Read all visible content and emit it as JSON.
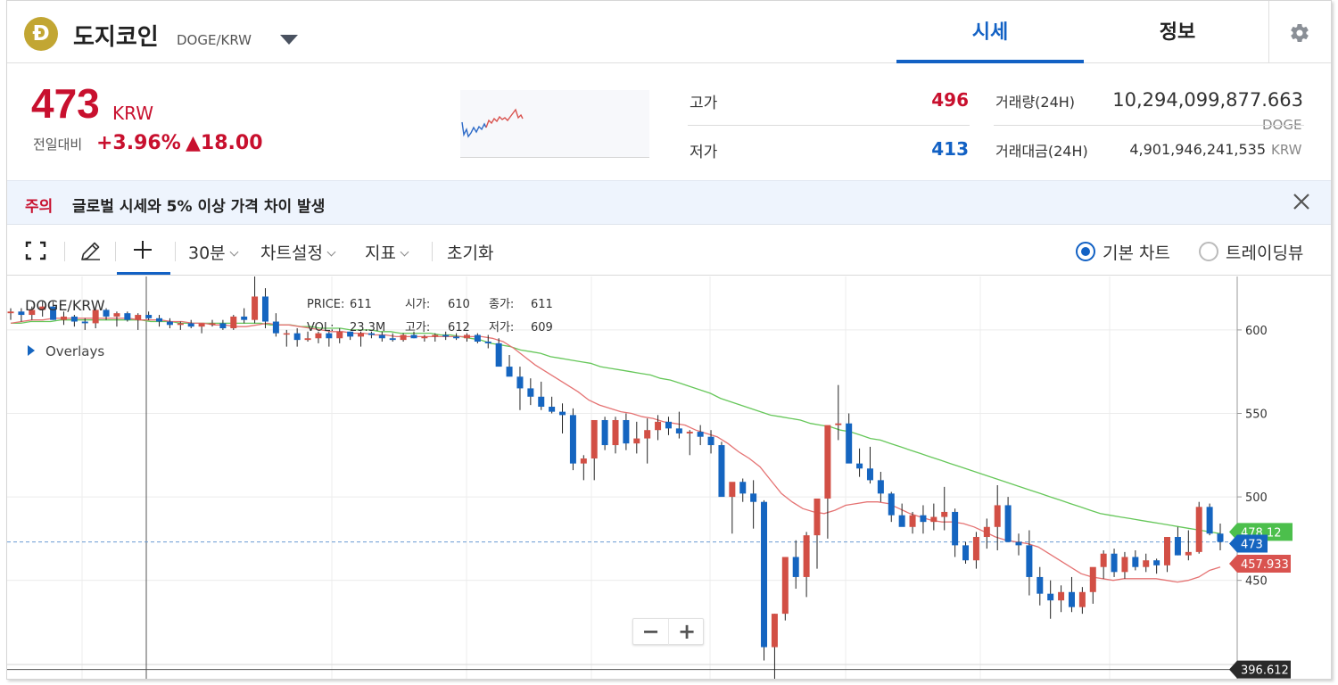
{
  "header": {
    "coin_symbol_glyph": "Ð",
    "coin_name": "도지코인",
    "pair": "DOGE/KRW",
    "tabs": [
      {
        "label": "시세",
        "active": true
      },
      {
        "label": "정보",
        "active": false
      }
    ]
  },
  "price": {
    "current": "473",
    "unit": "KRW",
    "prev_label": "전일대비",
    "change_pct": "+3.96%",
    "change_abs": "▲18.00"
  },
  "stats": {
    "high_label": "고가",
    "high_value": "496",
    "low_label": "저가",
    "low_value": "413",
    "volume_label": "거래량(24H)",
    "volume_value": "10,294,099,877.663",
    "volume_unit": "DOGE",
    "turnover_label": "거래대금(24H)",
    "turnover_value": "4,901,946,241,535",
    "turnover_unit": "KRW"
  },
  "warning": {
    "tag": "주의",
    "text": "글로벌 시세와 5% 이상 가격 차이 발생"
  },
  "toolbar": {
    "interval": "30분",
    "chart_settings": "차트설정",
    "indicators": "지표",
    "reset": "초기화",
    "basic_chart": "기본 차트",
    "tradingview": "트레이딩뷰"
  },
  "colors": {
    "up": "#c8102e",
    "down": "#1261c4",
    "candle_up": "#d24f45",
    "candle_down": "#1565c0",
    "ma_short": "#e57373",
    "ma_long": "#66c75a",
    "accent": "#1261c4"
  },
  "chart_data": {
    "type": "candlestick",
    "pair_label": "DOGE/KRW",
    "overlays_label": "Overlays",
    "legend": {
      "price_label": "PRICE:",
      "price": "611",
      "open_label": "시가:",
      "open": "610",
      "close_label": "종가:",
      "close": "611",
      "vol_label": "VOL:",
      "vol": "23.3M",
      "high_label": "고가:",
      "high": "612",
      "low_label": "저가:",
      "low": "609"
    },
    "ylim": [
      390,
      632
    ],
    "y_ticks": [
      "600",
      "550",
      "500",
      "450"
    ],
    "current_price_label": "473",
    "ma_short_label": "457.933",
    "ma_long_label": "478.12",
    "crosshair_label": "396.612",
    "candles": [
      [
        610,
        613,
        606,
        611
      ],
      [
        611,
        613,
        605,
        609
      ],
      [
        609,
        614,
        606,
        612
      ],
      [
        612,
        617,
        608,
        614
      ],
      [
        614,
        617,
        606,
        606
      ],
      [
        606,
        611,
        603,
        608
      ],
      [
        608,
        609,
        602,
        605
      ],
      [
        605,
        607,
        600,
        604
      ],
      [
        604,
        614,
        601,
        612
      ],
      [
        612,
        613,
        606,
        608
      ],
      [
        608,
        611,
        602,
        610
      ],
      [
        610,
        611,
        605,
        606
      ],
      [
        606,
        610,
        600,
        609
      ],
      [
        609,
        611,
        606,
        607
      ],
      [
        607,
        609,
        602,
        605
      ],
      [
        605,
        607,
        601,
        603
      ],
      [
        603,
        605,
        600,
        604
      ],
      [
        604,
        606,
        601,
        602
      ],
      [
        602,
        604,
        598,
        604
      ],
      [
        604,
        606,
        602,
        604
      ],
      [
        604,
        606,
        600,
        601
      ],
      [
        601,
        609,
        600,
        608
      ],
      [
        608,
        613,
        604,
        606
      ],
      [
        606,
        634,
        604,
        620
      ],
      [
        620,
        625,
        601,
        605
      ],
      [
        605,
        610,
        596,
        598
      ],
      [
        598,
        600,
        590,
        598
      ],
      [
        598,
        601,
        590,
        594
      ],
      [
        594,
        599,
        593,
        595
      ],
      [
        595,
        599,
        592,
        598
      ],
      [
        598,
        599,
        590,
        595
      ],
      [
        595,
        601,
        592,
        599
      ],
      [
        599,
        599,
        594,
        596
      ],
      [
        596,
        599,
        590,
        598
      ],
      [
        598,
        599,
        595,
        597
      ],
      [
        597,
        599,
        593,
        595
      ],
      [
        595,
        598,
        593,
        594
      ],
      [
        594,
        598,
        593,
        597
      ],
      [
        597,
        599,
        595,
        595
      ],
      [
        595,
        597,
        593,
        596
      ],
      [
        596,
        598,
        593,
        597
      ],
      [
        597,
        599,
        594,
        596
      ],
      [
        596,
        598,
        594,
        595
      ],
      [
        595,
        598,
        593,
        597
      ],
      [
        597,
        598,
        592,
        593
      ],
      [
        593,
        597,
        589,
        592
      ],
      [
        592,
        595,
        585,
        578
      ],
      [
        578,
        585,
        575,
        572
      ],
      [
        572,
        578,
        552,
        565
      ],
      [
        565,
        571,
        555,
        560
      ],
      [
        560,
        569,
        552,
        554
      ],
      [
        554,
        560,
        550,
        551
      ],
      [
        551,
        556,
        538,
        549
      ],
      [
        549,
        553,
        516,
        520
      ],
      [
        520,
        525,
        510,
        523
      ],
      [
        523,
        545,
        510,
        546
      ],
      [
        546,
        548,
        528,
        531
      ],
      [
        531,
        548,
        526,
        546
      ],
      [
        546,
        550,
        528,
        532
      ],
      [
        532,
        545,
        526,
        535
      ],
      [
        535,
        547,
        520,
        540
      ],
      [
        540,
        549,
        534,
        545
      ],
      [
        545,
        548,
        537,
        541
      ],
      [
        541,
        551,
        535,
        538
      ],
      [
        538,
        540,
        525,
        539
      ],
      [
        539,
        543,
        531,
        536
      ],
      [
        536,
        540,
        526,
        531
      ],
      [
        531,
        533,
        510,
        500
      ],
      [
        500,
        508,
        478,
        509
      ],
      [
        509,
        511,
        497,
        502
      ],
      [
        502,
        510,
        481,
        497
      ],
      [
        497,
        498,
        402,
        410
      ],
      [
        410,
        430,
        380,
        430
      ],
      [
        430,
        464,
        426,
        464
      ],
      [
        464,
        474,
        445,
        452
      ],
      [
        452,
        479,
        440,
        477
      ],
      [
        477,
        499,
        457,
        499
      ],
      [
        499,
        520,
        475,
        543
      ],
      [
        543,
        567,
        534,
        544
      ],
      [
        544,
        550,
        523,
        520
      ],
      [
        520,
        529,
        512,
        517
      ],
      [
        517,
        530,
        508,
        510
      ],
      [
        510,
        515,
        497,
        502
      ],
      [
        502,
        503,
        485,
        489
      ],
      [
        489,
        496,
        484,
        482
      ],
      [
        482,
        491,
        478,
        489
      ],
      [
        489,
        495,
        478,
        485
      ],
      [
        485,
        496,
        480,
        488
      ],
      [
        488,
        506,
        480,
        491
      ],
      [
        491,
        493,
        464,
        471
      ],
      [
        471,
        473,
        460,
        462
      ],
      [
        462,
        479,
        457,
        476
      ],
      [
        476,
        487,
        469,
        482
      ],
      [
        482,
        507,
        468,
        495
      ],
      [
        495,
        500,
        473,
        473
      ],
      [
        473,
        478,
        465,
        471
      ],
      [
        471,
        480,
        441,
        452
      ],
      [
        452,
        458,
        435,
        442
      ],
      [
        442,
        450,
        427,
        438
      ],
      [
        438,
        447,
        431,
        443
      ],
      [
        443,
        452,
        431,
        434
      ],
      [
        434,
        446,
        430,
        443
      ],
      [
        443,
        449,
        436,
        458
      ],
      [
        458,
        468,
        451,
        466
      ],
      [
        466,
        469,
        452,
        455
      ],
      [
        455,
        467,
        451,
        464
      ],
      [
        464,
        468,
        456,
        458
      ],
      [
        458,
        466,
        455,
        462
      ],
      [
        462,
        463,
        454,
        459
      ],
      [
        459,
        476,
        455,
        476
      ],
      [
        476,
        482,
        465,
        465
      ],
      [
        465,
        480,
        462,
        467
      ],
      [
        467,
        497,
        466,
        494
      ],
      [
        494,
        496,
        477,
        478
      ],
      [
        478,
        484,
        468,
        473
      ]
    ],
    "ma_short": [
      604,
      605,
      606,
      606,
      607,
      607,
      607,
      607,
      607,
      607,
      607,
      607,
      606,
      606,
      606,
      605,
      605,
      604,
      604,
      603,
      603,
      602,
      602,
      603,
      604,
      603,
      603,
      602,
      601,
      600,
      599,
      599,
      598,
      598,
      597,
      597,
      596,
      596,
      596,
      596,
      596,
      596,
      596,
      596,
      596,
      595,
      593,
      589,
      584,
      579,
      575,
      571,
      567,
      563,
      558,
      555,
      553,
      551,
      550,
      548,
      547,
      545,
      544,
      543,
      540,
      538,
      536,
      532,
      527,
      523,
      518,
      510,
      502,
      497,
      493,
      491,
      490,
      492,
      495,
      496,
      497,
      497,
      496,
      493,
      490,
      488,
      486,
      485,
      485,
      484,
      482,
      479,
      476,
      474,
      473,
      472,
      470,
      466,
      462,
      458,
      454,
      452,
      451,
      450,
      451,
      451,
      451,
      451,
      450,
      449,
      450,
      452,
      456,
      458
    ],
    "ma_long": [
      604,
      604,
      605,
      605,
      605,
      606,
      606,
      606,
      606,
      606,
      606,
      606,
      606,
      606,
      605,
      605,
      605,
      604,
      604,
      604,
      604,
      604,
      604,
      604,
      604,
      604,
      603,
      603,
      603,
      602,
      602,
      601,
      601,
      601,
      600,
      600,
      600,
      599,
      599,
      598,
      598,
      598,
      598,
      597,
      597,
      596,
      595,
      594,
      592,
      591,
      590,
      588,
      587,
      586,
      584,
      583,
      582,
      581,
      580,
      578,
      577,
      576,
      575,
      574,
      573,
      571,
      570,
      568,
      566,
      564,
      562,
      559,
      557,
      555,
      553,
      551,
      549,
      548,
      547,
      546,
      544,
      543,
      542,
      540,
      539,
      537,
      535,
      534,
      532,
      530,
      528,
      526,
      524,
      522,
      520,
      518,
      516,
      514,
      512,
      510,
      508,
      506,
      504,
      502,
      500,
      498,
      496,
      494,
      492,
      490,
      489,
      488,
      487,
      486,
      485,
      484,
      483,
      482,
      481,
      480,
      479,
      478
    ]
  }
}
